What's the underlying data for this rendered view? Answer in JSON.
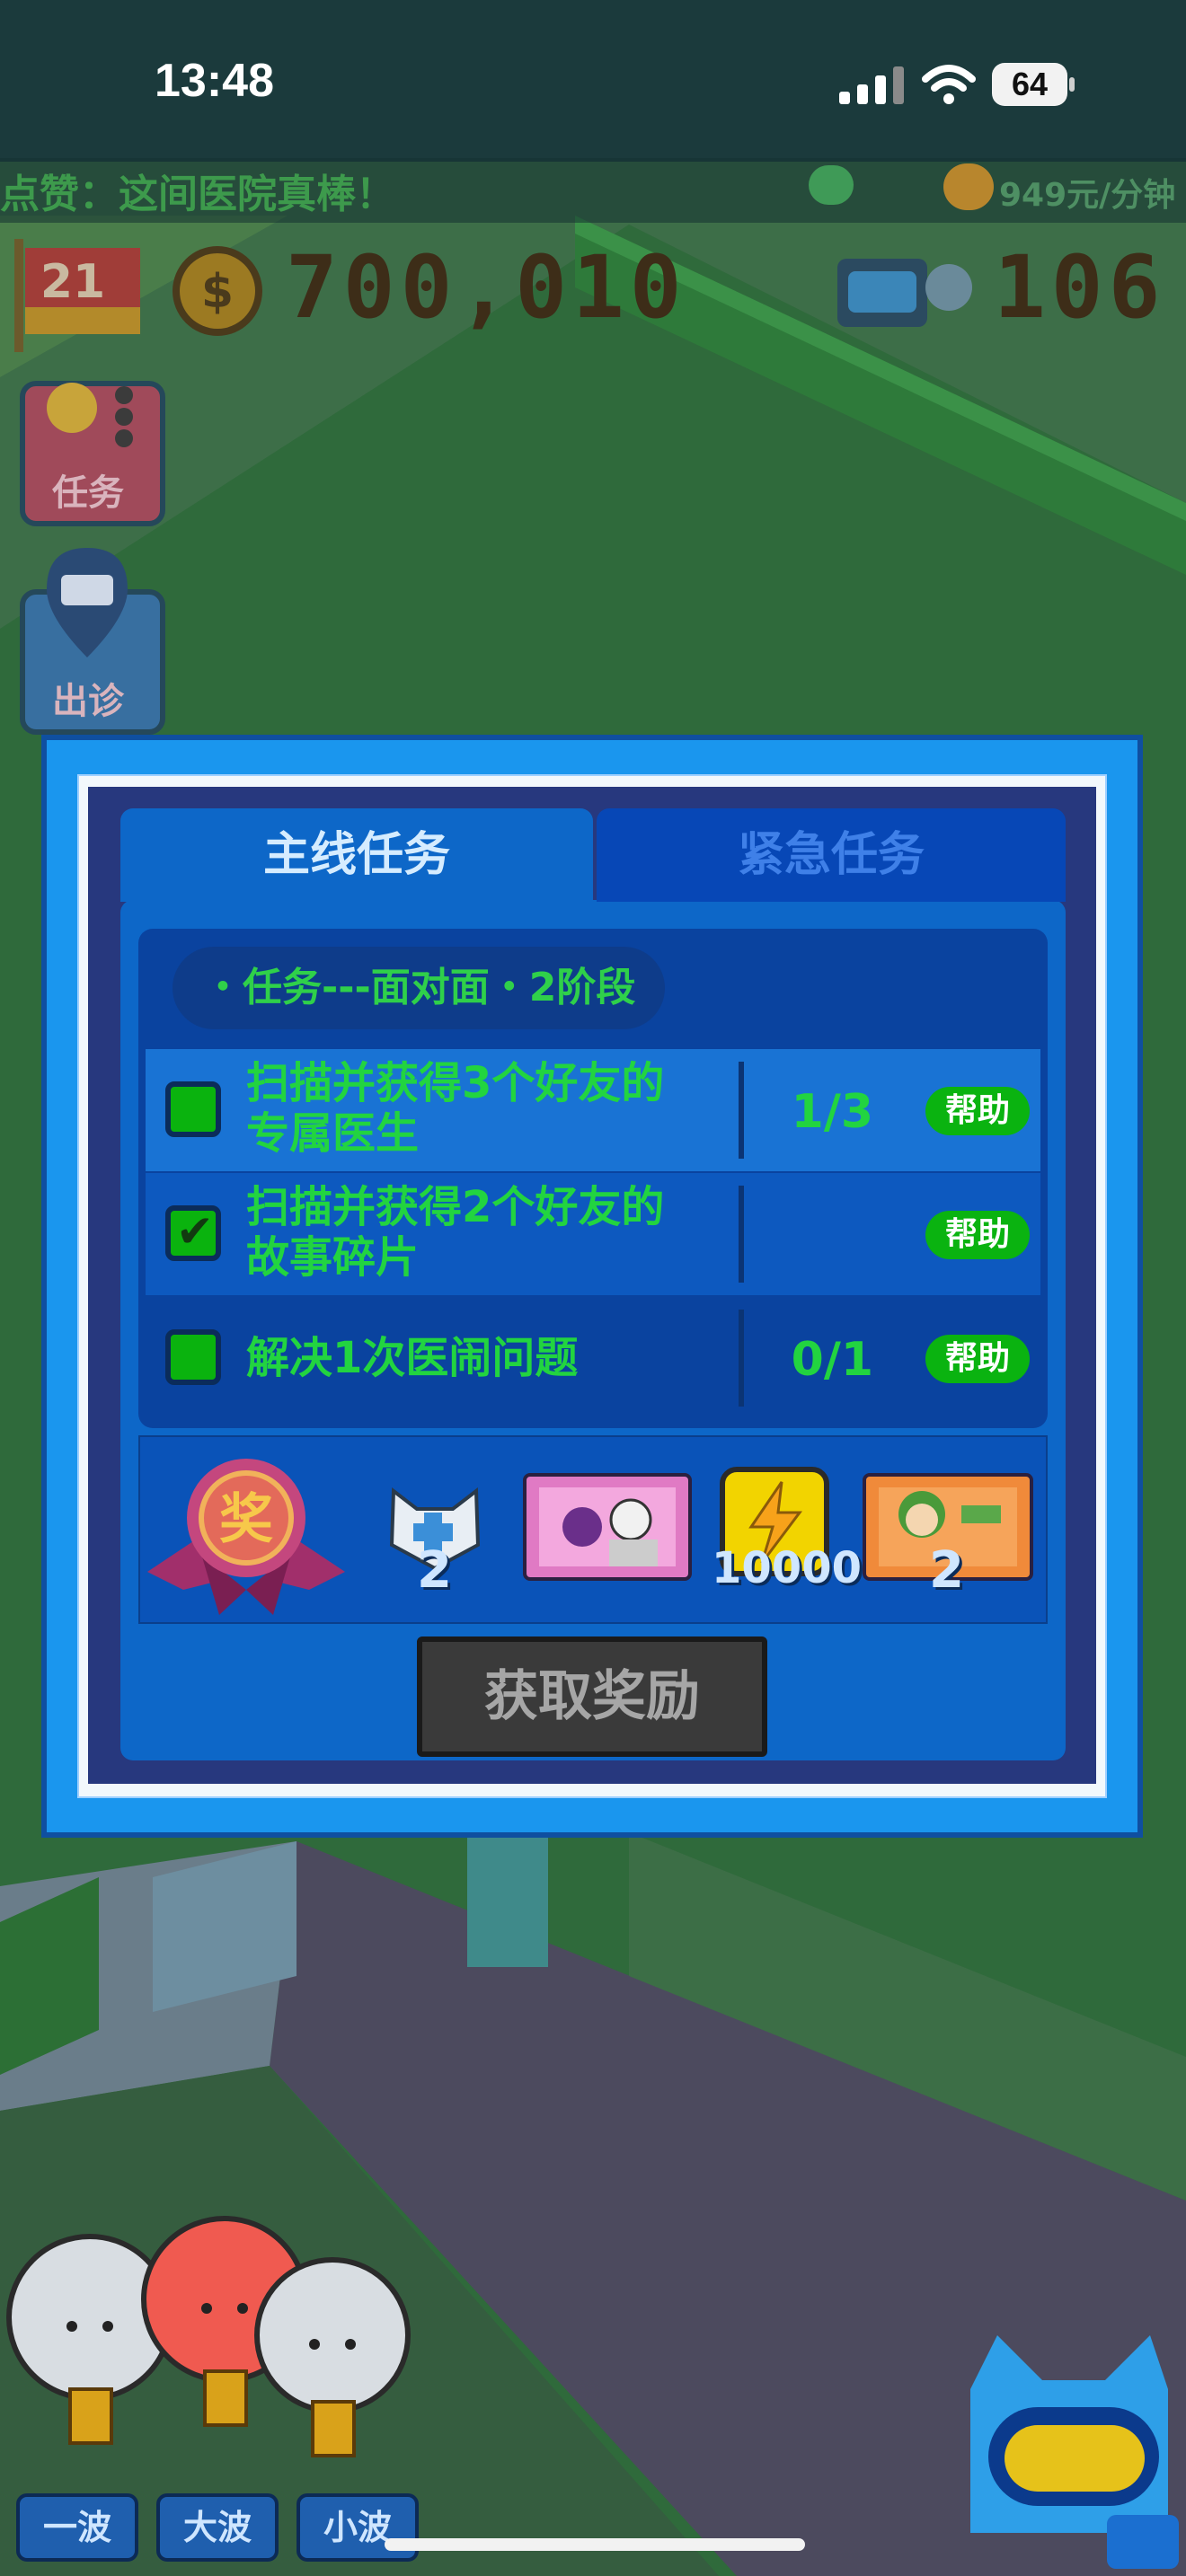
{
  "status_bar": {
    "time": "13:48",
    "battery": "64"
  },
  "ticker": {
    "message": "点赞：这间医院真棒！",
    "rate": "949元/分钟"
  },
  "hud": {
    "level": "21",
    "coins": "700,010",
    "secondary": "106"
  },
  "side_buttons": [
    {
      "label": "任务"
    },
    {
      "label": "出诊"
    }
  ],
  "dialog": {
    "tabs": [
      {
        "label": "主线任务",
        "active": true
      },
      {
        "label": "紧急任务",
        "active": false
      }
    ],
    "task_title": "・任务---面对面・2阶段",
    "tasks": [
      {
        "line1": "扫描并获得3个好友的",
        "line2": "专属医生",
        "progress": "1/3",
        "done": false,
        "help": "帮助"
      },
      {
        "line1": "扫描并获得2个好友的",
        "line2": "故事碎片",
        "progress": "",
        "done": true,
        "help": "帮助"
      },
      {
        "line1": "解决1次医闹问题",
        "line2": "",
        "progress": "0/1",
        "done": false,
        "help": "帮助"
      }
    ],
    "reward_badge": "奖",
    "rewards": [
      {
        "icon": "cat-cross-icon",
        "count": "2"
      },
      {
        "icon": "doctor-card-icon",
        "count": ""
      },
      {
        "icon": "lightning-icon",
        "count": "10000"
      },
      {
        "icon": "character-ticket-icon",
        "count": "2"
      }
    ],
    "claim_button": "获取奖励"
  },
  "waves": [
    {
      "label": "一波"
    },
    {
      "label": "大波"
    },
    {
      "label": "小波"
    }
  ],
  "colors": {
    "dialog_blue": "#1a96ee",
    "panel_blue": "#0d67c8",
    "task_green": "#22d440",
    "help_green": "#0ab310"
  }
}
